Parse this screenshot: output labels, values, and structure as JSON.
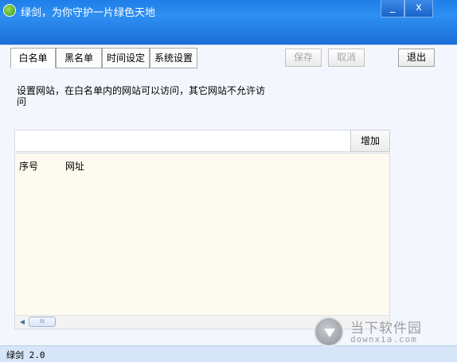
{
  "window": {
    "title": "绿剑，为你守护一片绿色天地",
    "minimize_label": "_",
    "close_label": "x"
  },
  "tabs": [
    {
      "label": "白名单",
      "active": true
    },
    {
      "label": "黑名单",
      "active": false
    },
    {
      "label": "时间设定",
      "active": false
    },
    {
      "label": "系统设置",
      "active": false
    }
  ],
  "toolbar": {
    "save_label": "保存",
    "cancel_label": "取消",
    "exit_label": "退出"
  },
  "description": "设置网站，在白名单内的网站可以访问，其它网站不允许访问",
  "url_input": {
    "value": "",
    "placeholder": ""
  },
  "add_label": "增加",
  "list": {
    "columns": [
      "序号",
      "网址"
    ],
    "rows": []
  },
  "scroll_thumb_label": "III",
  "status": "绿剑 2.0",
  "watermark": {
    "title": "当下软件园",
    "url": "downxia.com"
  },
  "colors": {
    "titlebar": "#1f7ee8",
    "background": "#f3f7fd",
    "list_bg": "#fdfbf0",
    "status_bg": "#d6e5f7"
  }
}
